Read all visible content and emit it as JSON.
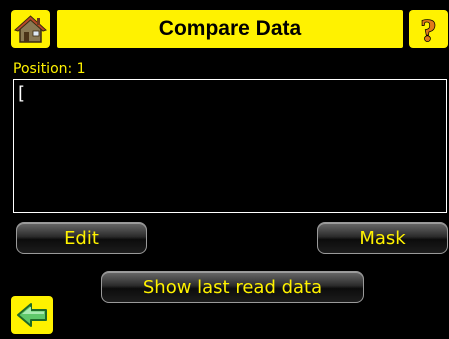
{
  "header": {
    "title": "Compare Data",
    "home_icon": "home-icon",
    "help_icon": "help-question-icon"
  },
  "position": {
    "label": "Position: 1"
  },
  "data_field": {
    "value": "["
  },
  "buttons": {
    "edit_label": "Edit",
    "mask_label": "Mask",
    "show_last_label": "Show last read data"
  },
  "footer": {
    "back_icon": "back-arrow-icon"
  },
  "colors": {
    "accent": "#fff200",
    "background": "#000000",
    "text_white": "#ffffff"
  }
}
